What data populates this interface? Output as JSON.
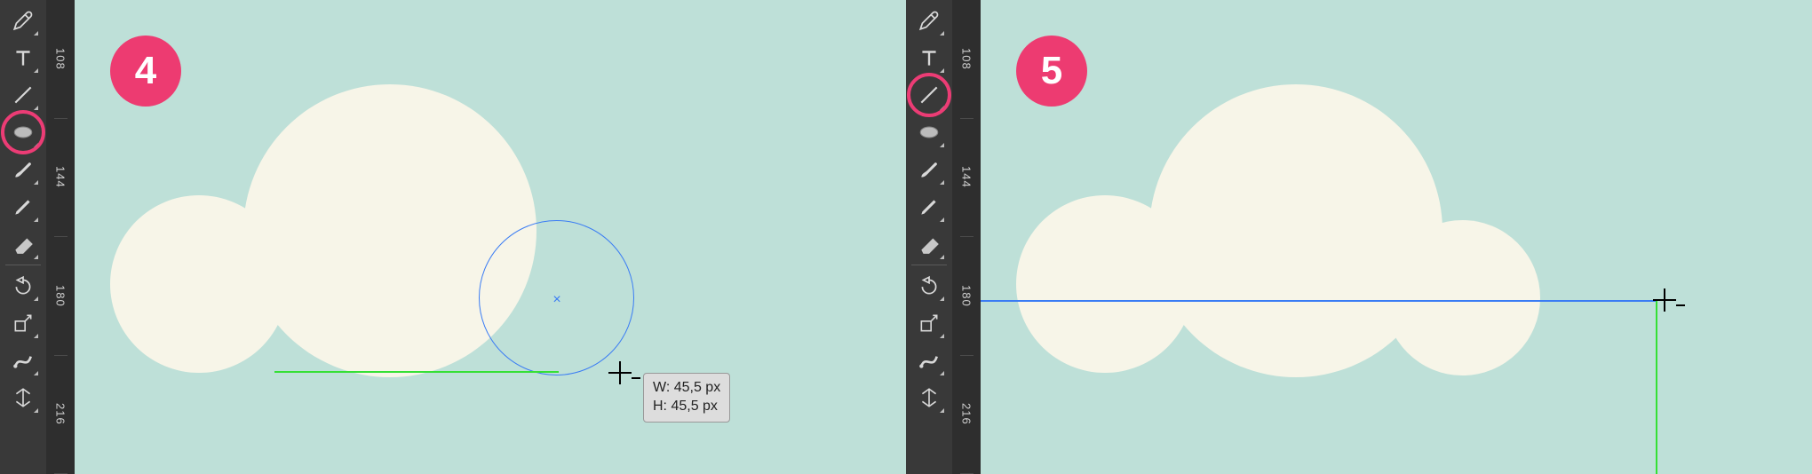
{
  "steps": {
    "left": {
      "badge": "4",
      "highlight_tool": "ellipse"
    },
    "right": {
      "badge": "5",
      "highlight_tool": "line"
    }
  },
  "ruler": {
    "marks": [
      "108",
      "144",
      "180",
      "216"
    ]
  },
  "tooltip": {
    "w_label": "W: 45,5 px",
    "h_label": "H: 45,5 px"
  },
  "tools": [
    {
      "id": "pen",
      "icon": "pen-icon",
      "tri": true
    },
    {
      "id": "type",
      "icon": "type-icon",
      "tri": true
    },
    {
      "id": "line",
      "icon": "line-icon",
      "tri": true
    },
    {
      "id": "ellipse",
      "icon": "ellipse-icon",
      "tri": true
    },
    {
      "id": "brush",
      "icon": "brush-icon",
      "tri": true
    },
    {
      "id": "pencil",
      "icon": "pencil-icon",
      "tri": true
    },
    {
      "id": "eraser",
      "icon": "eraser-icon",
      "tri": true
    },
    {
      "id": "sep",
      "sep": true
    },
    {
      "id": "rotate",
      "icon": "rotate-icon",
      "tri": true
    },
    {
      "id": "scale",
      "icon": "scale-icon",
      "tri": true
    },
    {
      "id": "width",
      "icon": "width-icon",
      "tri": true
    },
    {
      "id": "transform",
      "icon": "transform-icon",
      "tri": true
    }
  ],
  "icons": {
    "pen-icon": "pen",
    "type-icon": "T",
    "line-icon": "line",
    "ellipse-icon": "ellipse",
    "brush-icon": "brush",
    "pencil-icon": "pencil",
    "eraser-icon": "eraser",
    "rotate-icon": "rotate",
    "scale-icon": "scale",
    "width-icon": "width",
    "transform-icon": "transform"
  },
  "colors": {
    "accent": "#ed3b71",
    "canvas": "#bee0d8",
    "cloud": "#f7f5e8",
    "guide_green": "#35e035",
    "guide_blue": "#3a7cf4"
  }
}
